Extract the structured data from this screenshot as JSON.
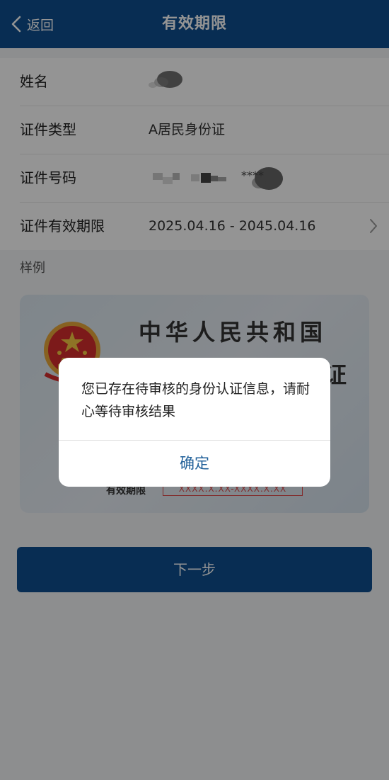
{
  "header": {
    "back_label": "返回",
    "title": "有效期限"
  },
  "form": {
    "rows": [
      {
        "label": "姓名",
        "value": ""
      },
      {
        "label": "证件类型",
        "value": "A居民身份证"
      },
      {
        "label": "证件号码",
        "value": "****"
      },
      {
        "label": "证件有效期限",
        "value": "2025.04.16 - 2045.04.16"
      }
    ]
  },
  "sample": {
    "label": "样例",
    "card_title": "中华人民共和国",
    "card_sub": "证",
    "validity_label": "有效期限",
    "validity_value": "XXXX.X.XX-XXXX.X.XX"
  },
  "next_button": {
    "label": "下一步"
  },
  "dialog": {
    "message": "您已存在待审核的身份认证信息，请耐心等待审核结果",
    "confirm_label": "确定"
  },
  "colors": {
    "header_bg": "#0e4f8f",
    "dialog_button_text": "#1f5f99",
    "overlay": "rgba(0,0,0,0.42)"
  },
  "icons": {
    "back": "chevron-left-icon",
    "row_arrow": "chevron-right-icon",
    "emblem": "national-emblem-icon"
  }
}
